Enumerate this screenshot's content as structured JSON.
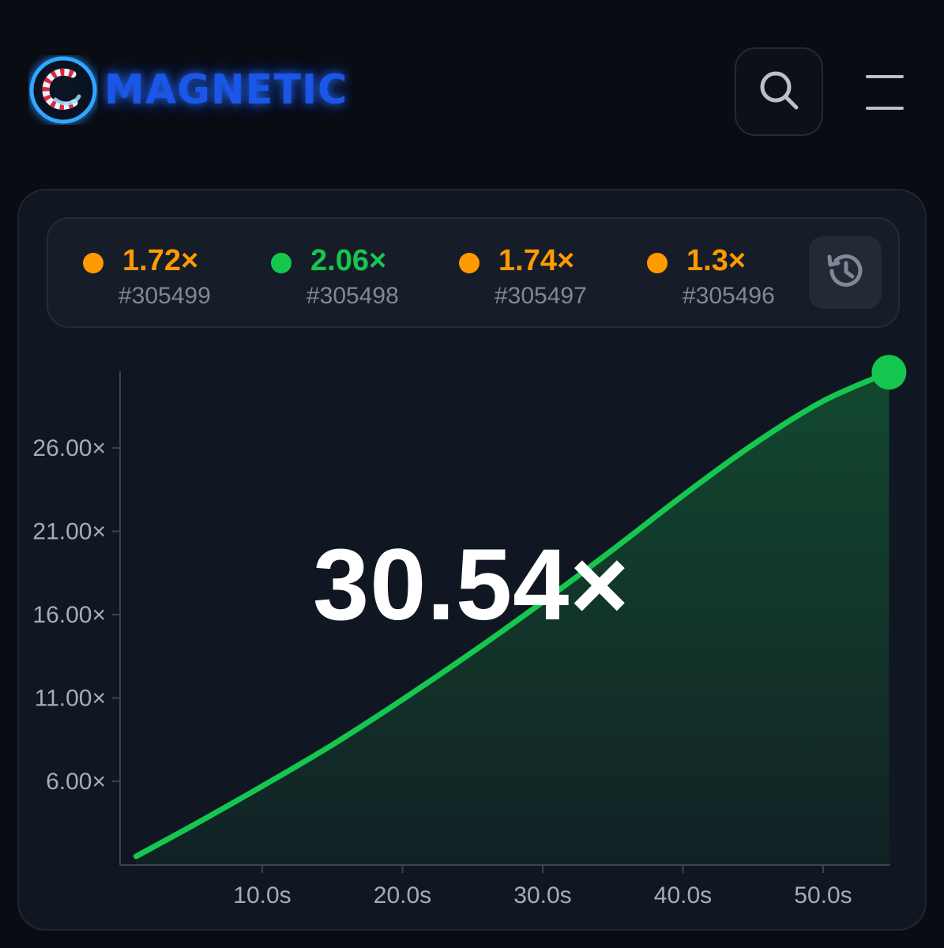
{
  "header": {
    "logo_text": "MAGNETIC",
    "search_icon": "search-icon",
    "menu_icon": "hamburger-menu-icon"
  },
  "history": {
    "items": [
      {
        "multiplier": "1.72×",
        "round": "#305499",
        "color": "#ff9a00"
      },
      {
        "multiplier": "2.06×",
        "round": "#305498",
        "color": "#15c74f"
      },
      {
        "multiplier": "1.74×",
        "round": "#305497",
        "color": "#ff9a00"
      },
      {
        "multiplier": "1.3×",
        "round": "#305496",
        "color": "#ff9a00"
      }
    ],
    "history_icon": "history-clock-icon"
  },
  "current_multiplier": "30.54×",
  "colors": {
    "accent_green": "#15c74f",
    "accent_orange": "#ff9a00",
    "logo_blue": "#1a56e8"
  },
  "chart_data": {
    "type": "area",
    "x_tick_labels": [
      "10.0s",
      "20.0s",
      "30.0s",
      "40.0s",
      "50.0s"
    ],
    "y_tick_labels": [
      "6.00×",
      "11.00×",
      "16.00×",
      "21.00×",
      "26.00×"
    ],
    "x": [
      1,
      5,
      10,
      15,
      20,
      25,
      30,
      35,
      40,
      45,
      50,
      54.7
    ],
    "y": [
      1.5,
      3.33,
      5.71,
      8.19,
      10.9,
      13.76,
      16.76,
      19.9,
      23.14,
      26.2,
      28.81,
      30.54
    ],
    "xlabel": "",
    "ylabel": "",
    "xlim": [
      0,
      55
    ],
    "ylim": [
      1.0,
      30.54
    ],
    "grid": false,
    "line_color": "#15c74f"
  }
}
